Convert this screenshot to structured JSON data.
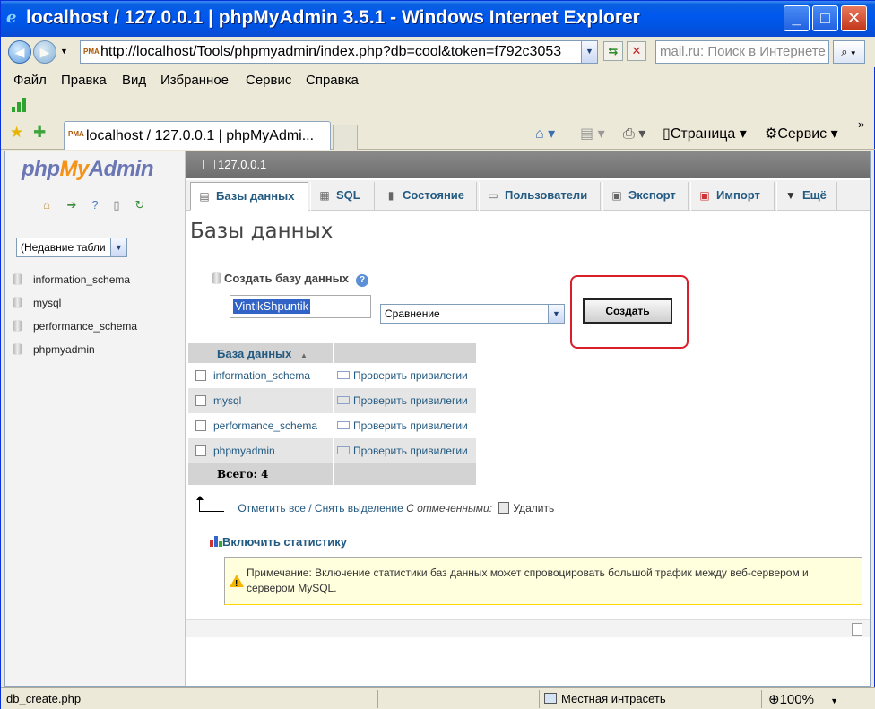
{
  "window": {
    "title": "localhost / 127.0.0.1 | phpMyAdmin 3.5.1 - Windows Internet Explorer",
    "address": "http://localhost/Tools/phpmyadmin/index.php?db=cool&token=f792c3053",
    "search_placeholder": "mail.ru: Поиск в Интернете"
  },
  "menu": [
    "Файл",
    "Правка",
    "Вид",
    "Избранное",
    "Сервис",
    "Справка"
  ],
  "browser_tab": {
    "label": "localhost / 127.0.0.1 | phpMyAdmi..."
  },
  "commands": {
    "page": "Страница",
    "tools": "Сервис"
  },
  "sidebar": {
    "logo": {
      "php": "php",
      "my": "My",
      "admin": "Admin"
    },
    "recent_tables": "(Недавние табли",
    "databases": [
      "information_schema",
      "mysql",
      "performance_schema",
      "phpmyadmin"
    ]
  },
  "server": "127.0.0.1",
  "tabs": [
    {
      "label": "Базы данных",
      "icon": "database-icon"
    },
    {
      "label": "SQL",
      "icon": "sql-icon"
    },
    {
      "label": "Состояние",
      "icon": "status-chart-icon"
    },
    {
      "label": "Пользователи",
      "icon": "users-icon"
    },
    {
      "label": "Экспорт",
      "icon": "export-icon"
    },
    {
      "label": "Импорт",
      "icon": "import-icon"
    },
    {
      "label": "Ещё",
      "icon": "more-triangle-icon"
    }
  ],
  "page_title": "Базы данных",
  "create_db": {
    "label": "Создать базу данных",
    "name_value": "VintikShpuntik",
    "collation": "Сравнение",
    "button": "Создать"
  },
  "db_table": {
    "header": "База данных",
    "rows": [
      {
        "name": "information_schema",
        "action": "Проверить привилегии"
      },
      {
        "name": "mysql",
        "action": "Проверить привилегии"
      },
      {
        "name": "performance_schema",
        "action": "Проверить привилегии"
      },
      {
        "name": "phpmyadmin",
        "action": "Проверить привилегии"
      }
    ],
    "total": "Всего: 4"
  },
  "selection": {
    "check_all": "Отметить все",
    "separator": " / ",
    "uncheck_all": "Снять выделение",
    "with_selected": "С отмеченными:",
    "delete": "Удалить"
  },
  "enable_stats": "Включить статистику",
  "notice": "Примечание: Включение статистики баз данных может спровоцировать большой трафик между веб-сервером и сервером MySQL.",
  "statusbar": {
    "left": "db_create.php",
    "zone": "Местная интрасеть",
    "zoom": "100%"
  },
  "colors": {
    "accent": "#235a81",
    "highlight_box": "#d9202a",
    "titlebar": "#0054e3"
  }
}
